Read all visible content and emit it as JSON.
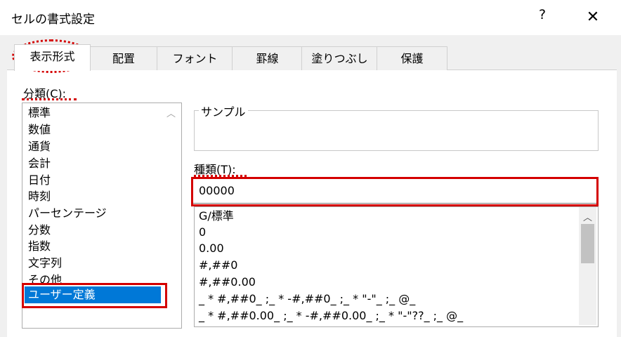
{
  "window": {
    "title": "セルの書式設定",
    "help": "?",
    "close": "✕"
  },
  "tabs": [
    "表示形式",
    "配置",
    "フォント",
    "罫線",
    "塗りつぶし",
    "保護"
  ],
  "category_label": "分類(C):",
  "categories": [
    "標準",
    "数値",
    "通貨",
    "会計",
    "日付",
    "時刻",
    "パーセンテージ",
    "分数",
    "指数",
    "文字列",
    "その他",
    "ユーザー定義"
  ],
  "selected_category": "ユーザー定義",
  "sample_label": "サンプル",
  "type_label": "種類(T):",
  "type_value": "00000",
  "formats": [
    "G/標準",
    "0",
    "0.00",
    "#,##0",
    "#,##0.00",
    "_ * #,##0_ ;_ * -#,##0_ ;_ * \"-\"_ ;_ @_",
    "_ * #,##0.00_ ;_ * -#,##0.00_ ;_ * \"-\"??_ ;_ @_"
  ],
  "colors": {
    "highlight": "#d40000",
    "selection": "#0078d7"
  }
}
